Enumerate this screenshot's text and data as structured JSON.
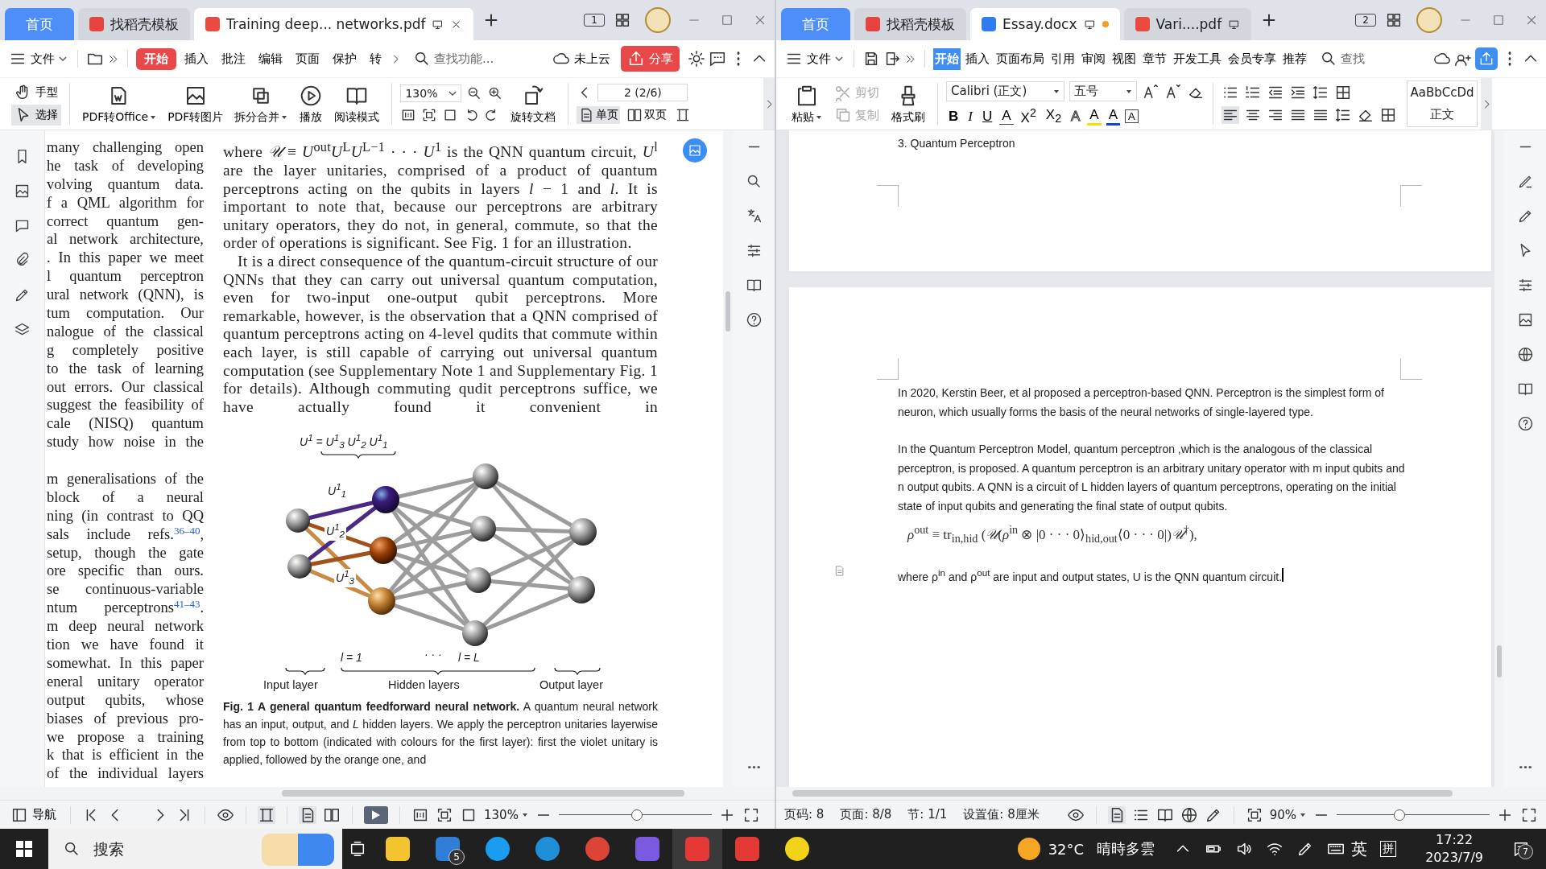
{
  "left_window": {
    "window_number": "1",
    "tabs": [
      {
        "label": "首页",
        "kind": "home",
        "selected": false
      },
      {
        "label": "找稻壳模板",
        "kind": "template",
        "selected": false
      },
      {
        "label": "Training deep... networks.pdf",
        "kind": "pdf",
        "selected": true,
        "modified": false
      }
    ],
    "menu": {
      "file": "文件",
      "tabs": [
        {
          "label": "开始",
          "selected": true
        },
        {
          "label": "插入",
          "selected": false
        },
        {
          "label": "批注",
          "selected": false
        },
        {
          "label": "编辑",
          "selected": false
        },
        {
          "label": "页面",
          "selected": false
        },
        {
          "label": "保护",
          "selected": false
        },
        {
          "label": "转",
          "selected": false
        }
      ],
      "search": {
        "placeholder": "查找功能..."
      },
      "cloud": "未上云",
      "share": "分享"
    },
    "toolbar": {
      "modes": [
        {
          "label": "手型",
          "selected": false
        },
        {
          "label": "选择",
          "selected": true
        }
      ],
      "tools": [
        {
          "label": "PDF转Office",
          "dropdown": true
        },
        {
          "label": "PDF转图片",
          "dropdown": false
        },
        {
          "label": "拆分合并",
          "dropdown": true
        },
        {
          "label": "播放",
          "dropdown": false
        },
        {
          "label": "阅读模式",
          "dropdown": false
        }
      ],
      "zoom": "130%",
      "rotate": "旋转文档",
      "page": "2 (2/6)",
      "views": [
        {
          "label": "单页",
          "selected": true
        },
        {
          "label": "双页",
          "selected": false
        }
      ]
    },
    "page": {
      "left_column": [
        {
          "text": "many challenging open"
        },
        {
          "text": "he task of developing"
        },
        {
          "text": "volving quantum data."
        },
        {
          "text": "f a QML algorithm for"
        },
        {
          "text": "correct quantum gen-"
        },
        {
          "text": "al network architecture,"
        },
        {
          "text": ". In this paper we meet"
        },
        {
          "text": "l quantum perceptron"
        },
        {
          "text": "ural network (QNN), is"
        },
        {
          "text": "tum computation. Our"
        },
        {
          "text": "nalogue of the classical"
        },
        {
          "text": "g completely positive"
        },
        {
          "text": "to the task of learning"
        },
        {
          "text": "out errors. Our classical"
        },
        {
          "text": "suggest the feasibility of"
        },
        {
          "text": "cale (NISQ) quantum"
        },
        {
          "text": "study how noise in the"
        },
        {
          "text": "m generalisations of the"
        },
        {
          "text": "block of a neural"
        },
        {
          "text": "ning (in contrast to QQ"
        },
        {
          "text": "sals include refs.",
          "ref": "36–40",
          "tail": ","
        },
        {
          "text": "setup, though the gate"
        },
        {
          "text": "ore specific than ours."
        },
        {
          "text": "se continuous-variable"
        },
        {
          "text": "ntum perceptrons",
          "ref": "41–43",
          "tail": "."
        },
        {
          "text": "m deep neural network"
        },
        {
          "text": "tion we have found it"
        },
        {
          "text": "somewhat. In this paper"
        },
        {
          "text": "eneral unitary operator"
        },
        {
          "text": "output qubits, whose"
        },
        {
          "text": "biases of previous pro-"
        },
        {
          "text": "we propose a training"
        },
        {
          "text": "k that is efficient in the"
        },
        {
          "text": "of the individual layers"
        }
      ],
      "paragraphs": [
        "where *𝒰* ≡ *U*$^{out}$*U*$^{L}$*U*$^{L−1}$ · · · *U*$^{1}$ is the QNN quantum circuit, *U*$^{l}$ are the layer unitaries, comprised of a product of quantum perceptrons acting on the qubits in layers *l* − 1 and *l*. It is important to note that, because our perceptrons are arbitrary unitary operators, they do not, in general, commute, so that the order of operations is significant. See Fig. 1 for an illustration.",
        "It is a direct consequence of the quantum-circuit structure of our QNNs that they can carry out universal quantum computation, even for two-input one-output qubit perceptrons. More remarkable, however, is the observation that a QNN comprised of quantum perceptrons acting on 4-level qudits that commute within each layer, is still capable of carrying out universal quantum computation (see Supplementary Note 1 and Supplementary Fig. 1 for details). Although commuting qudit perceptrons suffice, we have actually found it convenient in"
      ],
      "figure": {
        "product": "U$^{1}$ = U$^{1}$$_{3}$ U$^{1}$$_{2}$ U$^{1}$$_{1}$",
        "unitaries": [
          "U$^{1}$$_{1}$",
          "U$^{1}$$_{2}$",
          "U$^{1}$$_{3}$"
        ],
        "layer_first": "l = 1",
        "dots": "· · ·",
        "layer_last": "l = L",
        "axis": [
          "Input layer",
          "Hidden layers",
          "Output layer"
        ]
      },
      "caption": "**Fig. 1 A general quantum feedforward neural network.** A quantum neural network has an input, output, and *L* hidden layers. We apply the perceptron unitaries layerwise from top to bottom (indicated with colours for the first layer): first the violet unitary is applied, followed by the orange one, and"
    },
    "status": {
      "nav": "导航",
      "zoom": "130%",
      "level": 0.51
    }
  },
  "right_window": {
    "window_number": "2",
    "tabs": [
      {
        "label": "首页",
        "kind": "home",
        "selected": false
      },
      {
        "label": "找稻壳模板",
        "kind": "template",
        "selected": false
      },
      {
        "label": "Essay.docx",
        "kind": "doc",
        "selected": true,
        "modified": true
      },
      {
        "label": "Vari....pdf",
        "kind": "pdf",
        "selected": false,
        "modified": false
      }
    ],
    "menu": {
      "file": "文件",
      "tabs": [
        {
          "label": "开始",
          "selected": true
        },
        {
          "label": "插入",
          "selected": false
        },
        {
          "label": "页面布局",
          "selected": false
        },
        {
          "label": "引用",
          "selected": false
        },
        {
          "label": "审阅",
          "selected": false
        },
        {
          "label": "视图",
          "selected": false
        },
        {
          "label": "章节",
          "selected": false
        },
        {
          "label": "开发工具",
          "selected": false
        },
        {
          "label": "会员专享",
          "selected": false
        },
        {
          "label": "推荐",
          "selected": false
        }
      ],
      "search": {
        "placeholder": "查找"
      }
    },
    "toolbar": {
      "paste": "粘贴",
      "cut": {
        "label": "剪切",
        "disabled": true
      },
      "copy": {
        "label": "复制",
        "disabled": true
      },
      "format_painter": "格式刷",
      "font": "Calibri (正文)",
      "size": "五号",
      "formats": [
        "B",
        "I",
        "U",
        "A",
        "X$^{2}$",
        "X$_{2}$",
        "A",
        "A",
        "A",
        "A"
      ],
      "style_preview": "AaBbCcDd",
      "style_name": "正文"
    },
    "document": {
      "heading": "3.  Quantum Perceptron",
      "paragraphs": [
        "In 2020, Kerstin Beer, et al proposed a perceptron-based QNN. Perceptron is the simplest form of neuron, which usually forms the basis of the neural networks of single-layered type.",
        "In the Quantum Perceptron Model, quantum perceptron ,which is the analogous of the classical perceptron, is proposed. A quantum perceptron is an arbitrary unitary operator with m input qubits and n output qubits. A QNN is a circuit of L hidden layers of quantum perceptrons, operating on the initial state of input qubits and generating the final state of output qubits."
      ],
      "formula": "*ρ*$^{out}$ ≡ tr$_{in,hid}$ (*𝒰*(*ρ*$^{in}$ ⊗ |0 · · · 0⟩$_{hid,out}$⟨0 · · · 0|)*𝒰*$^{†}$),",
      "closing": "where ρ$^{in}$ and ρ$^{out}$ are input and output states, U is the QNN quantum circuit."
    },
    "status": {
      "fields": [
        "页码: 8",
        "页面: 8/8",
        "节: 1/1",
        "设置值: 8厘米"
      ],
      "zoom": "90%",
      "level": 0.41
    }
  },
  "taskbar": {
    "search": {
      "placeholder": "搜索"
    },
    "mail_badge": "5",
    "temperature": "32°C",
    "weather": "晴時多雲",
    "ime_language": "英",
    "ime_mode": "拼",
    "time": "17:22",
    "date": "2023/7/9",
    "notifications": "7"
  }
}
